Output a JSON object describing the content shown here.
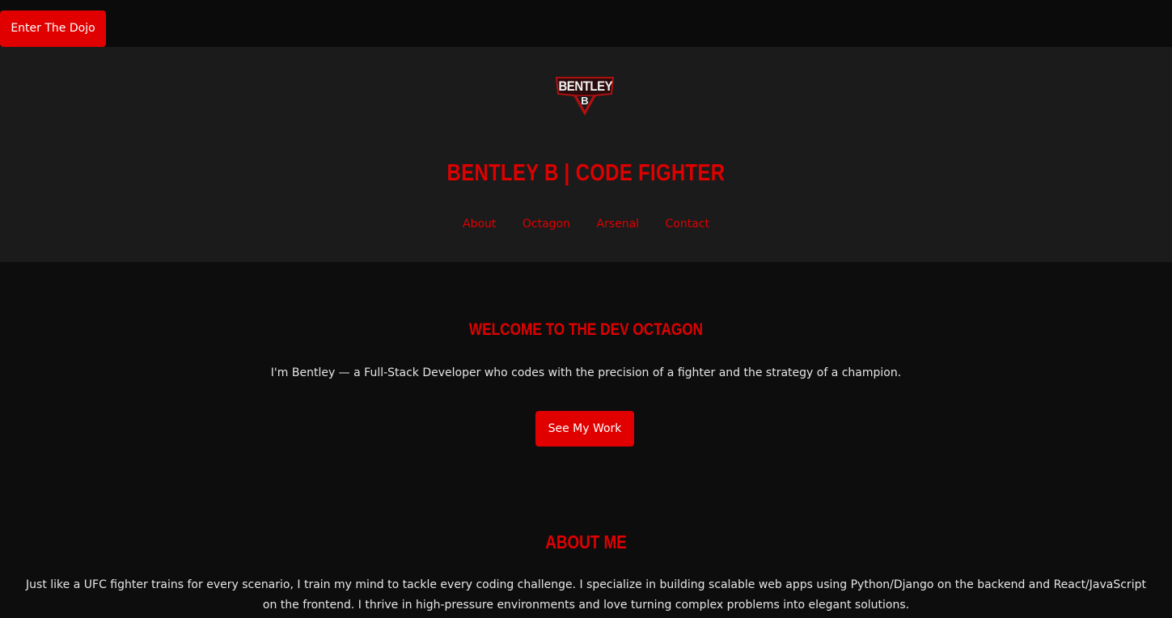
{
  "topbar": {
    "cta_label": "Enter The Dojo"
  },
  "header": {
    "logo": {
      "word": "BENTLEY",
      "letter": "B"
    },
    "title": "BENTLEY B | CODE FIGHTER",
    "nav": [
      {
        "label": "About"
      },
      {
        "label": "Octagon"
      },
      {
        "label": "Arsenal"
      },
      {
        "label": "Contact"
      }
    ]
  },
  "hero": {
    "title": "WELCOME TO THE DEV OCTAGON",
    "text": "I'm Bentley — a Full-Stack Developer who codes with the precision of a fighter and the strategy of a champion.",
    "button_label": "See My Work"
  },
  "about": {
    "title": "ABOUT ME",
    "text": "Just like a UFC fighter trains for every scenario, I train my mind to tackle every coding challenge. I specialize in building scalable web apps using Python/Django on the backend and React/JavaScript on the frontend. I thrive in high-pressure environments and love turning complex problems into elegant solutions."
  },
  "colors": {
    "accent": "#e00000",
    "background": "#0d0d0d",
    "header_background": "#1b1b1b",
    "text": "#e6e6e6"
  }
}
